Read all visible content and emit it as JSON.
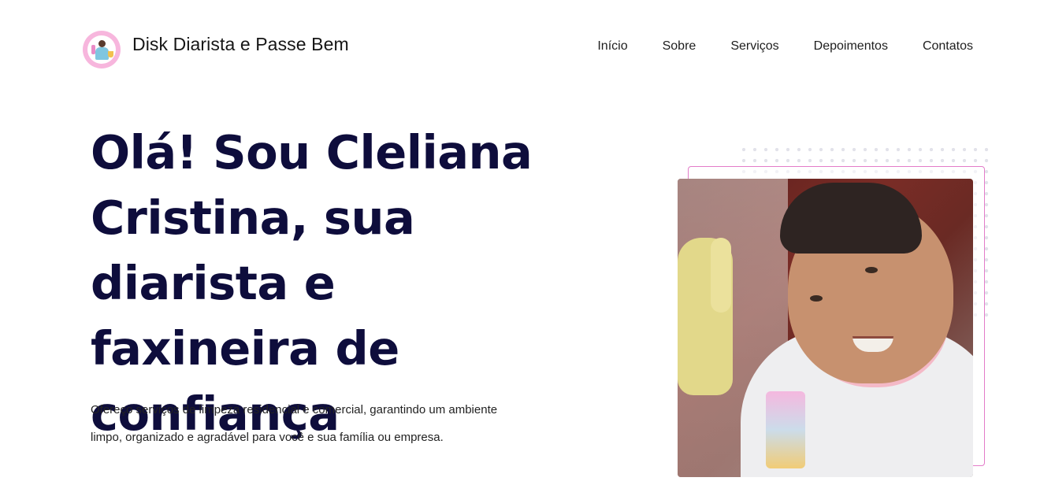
{
  "header": {
    "brand_name": "Disk Diarista e Passe Bem",
    "logo_icon": "cleaning-lady-logo-icon",
    "nav": [
      {
        "label": "Início"
      },
      {
        "label": "Sobre"
      },
      {
        "label": "Serviços"
      },
      {
        "label": "Depoimentos"
      },
      {
        "label": "Contatos"
      }
    ]
  },
  "hero": {
    "title": "Olá! Sou Cleliana Cristina, sua diarista e faxineira de confiança",
    "description": "Ofereço serviços de limpeza residencial e comercial, garantindo um ambiente limpo, organizado e agradável para você e sua família ou empresa.",
    "image_alt": "Foto de Cleliana Cristina com luva de limpeza fazendo sinal de positivo"
  },
  "colors": {
    "title": "#0e0d3c",
    "accent_pink": "#e37cc9",
    "logo_ring": "#f7b6dd"
  }
}
